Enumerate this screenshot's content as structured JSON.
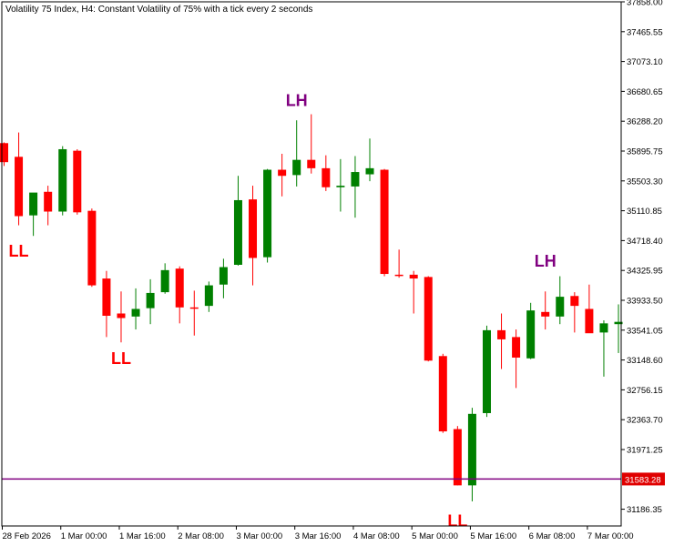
{
  "chart_data": {
    "type": "candlestick",
    "title": "Volatility 75 Index, H4:  Constant Volatility of 75% with a tick every 2 seconds",
    "ylim": [
      30966,
      37858
    ],
    "y_ticks": [
      "37858.00",
      "37465.55",
      "37073.10",
      "36680.65",
      "36288.20",
      "35895.75",
      "35503.30",
      "35110.85",
      "34718.40",
      "34325.95",
      "33933.50",
      "33541.05",
      "33148.60",
      "32756.15",
      "32363.70",
      "31971.25",
      "31186.35"
    ],
    "x_ticks": [
      {
        "label": "28 Feb 2026",
        "index": 0
      },
      {
        "label": "1 Mar 00:00",
        "index": 4
      },
      {
        "label": "1 Mar 16:00",
        "index": 8
      },
      {
        "label": "2 Mar 08:00",
        "index": 12
      },
      {
        "label": "3 Mar 00:00",
        "index": 16
      },
      {
        "label": "3 Mar 16:00",
        "index": 20
      },
      {
        "label": "4 Mar 08:00",
        "index": 24
      },
      {
        "label": "5 Mar 00:00",
        "index": 28
      },
      {
        "label": "5 Mar 16:00",
        "index": 32
      },
      {
        "label": "6 Mar 08:00",
        "index": 36
      },
      {
        "label": "7 Mar 00:00",
        "index": 40
      }
    ],
    "up_color": "#008000",
    "down_color": "#ff0000",
    "candles": [
      {
        "o": 36000,
        "h": 36010,
        "l": 35700,
        "c": 35750
      },
      {
        "o": 35820,
        "h": 36140,
        "l": 34920,
        "c": 35040
      },
      {
        "o": 35050,
        "h": 35340,
        "l": 34780,
        "c": 35350
      },
      {
        "o": 35360,
        "h": 35440,
        "l": 34920,
        "c": 35100
      },
      {
        "o": 35100,
        "h": 35960,
        "l": 35050,
        "c": 35920
      },
      {
        "o": 35900,
        "h": 35920,
        "l": 35060,
        "c": 35090
      },
      {
        "o": 35110,
        "h": 35140,
        "l": 34110,
        "c": 34130
      },
      {
        "o": 34220,
        "h": 34320,
        "l": 33450,
        "c": 33730
      },
      {
        "o": 33760,
        "h": 34050,
        "l": 33380,
        "c": 33700
      },
      {
        "o": 33720,
        "h": 34090,
        "l": 33550,
        "c": 33820
      },
      {
        "o": 33830,
        "h": 34210,
        "l": 33620,
        "c": 34030
      },
      {
        "o": 34040,
        "h": 34420,
        "l": 34020,
        "c": 34330
      },
      {
        "o": 34350,
        "h": 34380,
        "l": 33630,
        "c": 33840
      },
      {
        "o": 33840,
        "h": 34060,
        "l": 33470,
        "c": 33830
      },
      {
        "o": 33860,
        "h": 34180,
        "l": 33780,
        "c": 34130
      },
      {
        "o": 34140,
        "h": 34480,
        "l": 33960,
        "c": 34370
      },
      {
        "o": 34400,
        "h": 35570,
        "l": 34390,
        "c": 35250
      },
      {
        "o": 35260,
        "h": 35440,
        "l": 34130,
        "c": 34490
      },
      {
        "o": 34500,
        "h": 35660,
        "l": 34430,
        "c": 35650
      },
      {
        "o": 35650,
        "h": 35860,
        "l": 35300,
        "c": 35570
      },
      {
        "o": 35580,
        "h": 36300,
        "l": 35430,
        "c": 35780
      },
      {
        "o": 35780,
        "h": 36380,
        "l": 35600,
        "c": 35670
      },
      {
        "o": 35670,
        "h": 35840,
        "l": 35370,
        "c": 35420
      },
      {
        "o": 35420,
        "h": 35790,
        "l": 35100,
        "c": 35440
      },
      {
        "o": 35430,
        "h": 35830,
        "l": 35020,
        "c": 35620
      },
      {
        "o": 35590,
        "h": 36060,
        "l": 35500,
        "c": 35670
      },
      {
        "o": 35650,
        "h": 35660,
        "l": 34250,
        "c": 34280
      },
      {
        "o": 34270,
        "h": 34600,
        "l": 34230,
        "c": 34260
      },
      {
        "o": 34270,
        "h": 34320,
        "l": 33760,
        "c": 34220
      },
      {
        "o": 34240,
        "h": 34250,
        "l": 33130,
        "c": 33140
      },
      {
        "o": 33200,
        "h": 33230,
        "l": 32190,
        "c": 32210
      },
      {
        "o": 32240,
        "h": 32280,
        "l": 31500,
        "c": 31500
      },
      {
        "o": 31500,
        "h": 32520,
        "l": 31290,
        "c": 32440
      },
      {
        "o": 32450,
        "h": 33600,
        "l": 32400,
        "c": 33540
      },
      {
        "o": 33540,
        "h": 33760,
        "l": 33030,
        "c": 33420
      },
      {
        "o": 33450,
        "h": 33550,
        "l": 32780,
        "c": 33180
      },
      {
        "o": 33170,
        "h": 33900,
        "l": 33160,
        "c": 33800
      },
      {
        "o": 33780,
        "h": 34050,
        "l": 33550,
        "c": 33720
      },
      {
        "o": 33720,
        "h": 34250,
        "l": 33620,
        "c": 33980
      },
      {
        "o": 33990,
        "h": 34040,
        "l": 33510,
        "c": 33860
      },
      {
        "o": 33820,
        "h": 34140,
        "l": 33530,
        "c": 33500
      },
      {
        "o": 33510,
        "h": 33670,
        "l": 32930,
        "c": 33630
      },
      {
        "o": 33620,
        "h": 33880,
        "l": 33240,
        "c": 33650
      }
    ],
    "annotations": [
      {
        "text": "LL",
        "index": 1,
        "price": 34580,
        "color": "#ff0000"
      },
      {
        "text": "LL",
        "index": 8,
        "price": 33170,
        "color": "#ff0000"
      },
      {
        "text": "LH",
        "index": 20,
        "price": 36560,
        "color": "#800080"
      },
      {
        "text": "LL",
        "index": 31,
        "price": 31030,
        "color": "#ff0000"
      },
      {
        "text": "LH",
        "index": 37,
        "price": 34450,
        "color": "#800080"
      }
    ],
    "hline": {
      "value": 31583.28,
      "label": "31583.28",
      "color": "#800080",
      "tag_color": "#e00000"
    }
  }
}
